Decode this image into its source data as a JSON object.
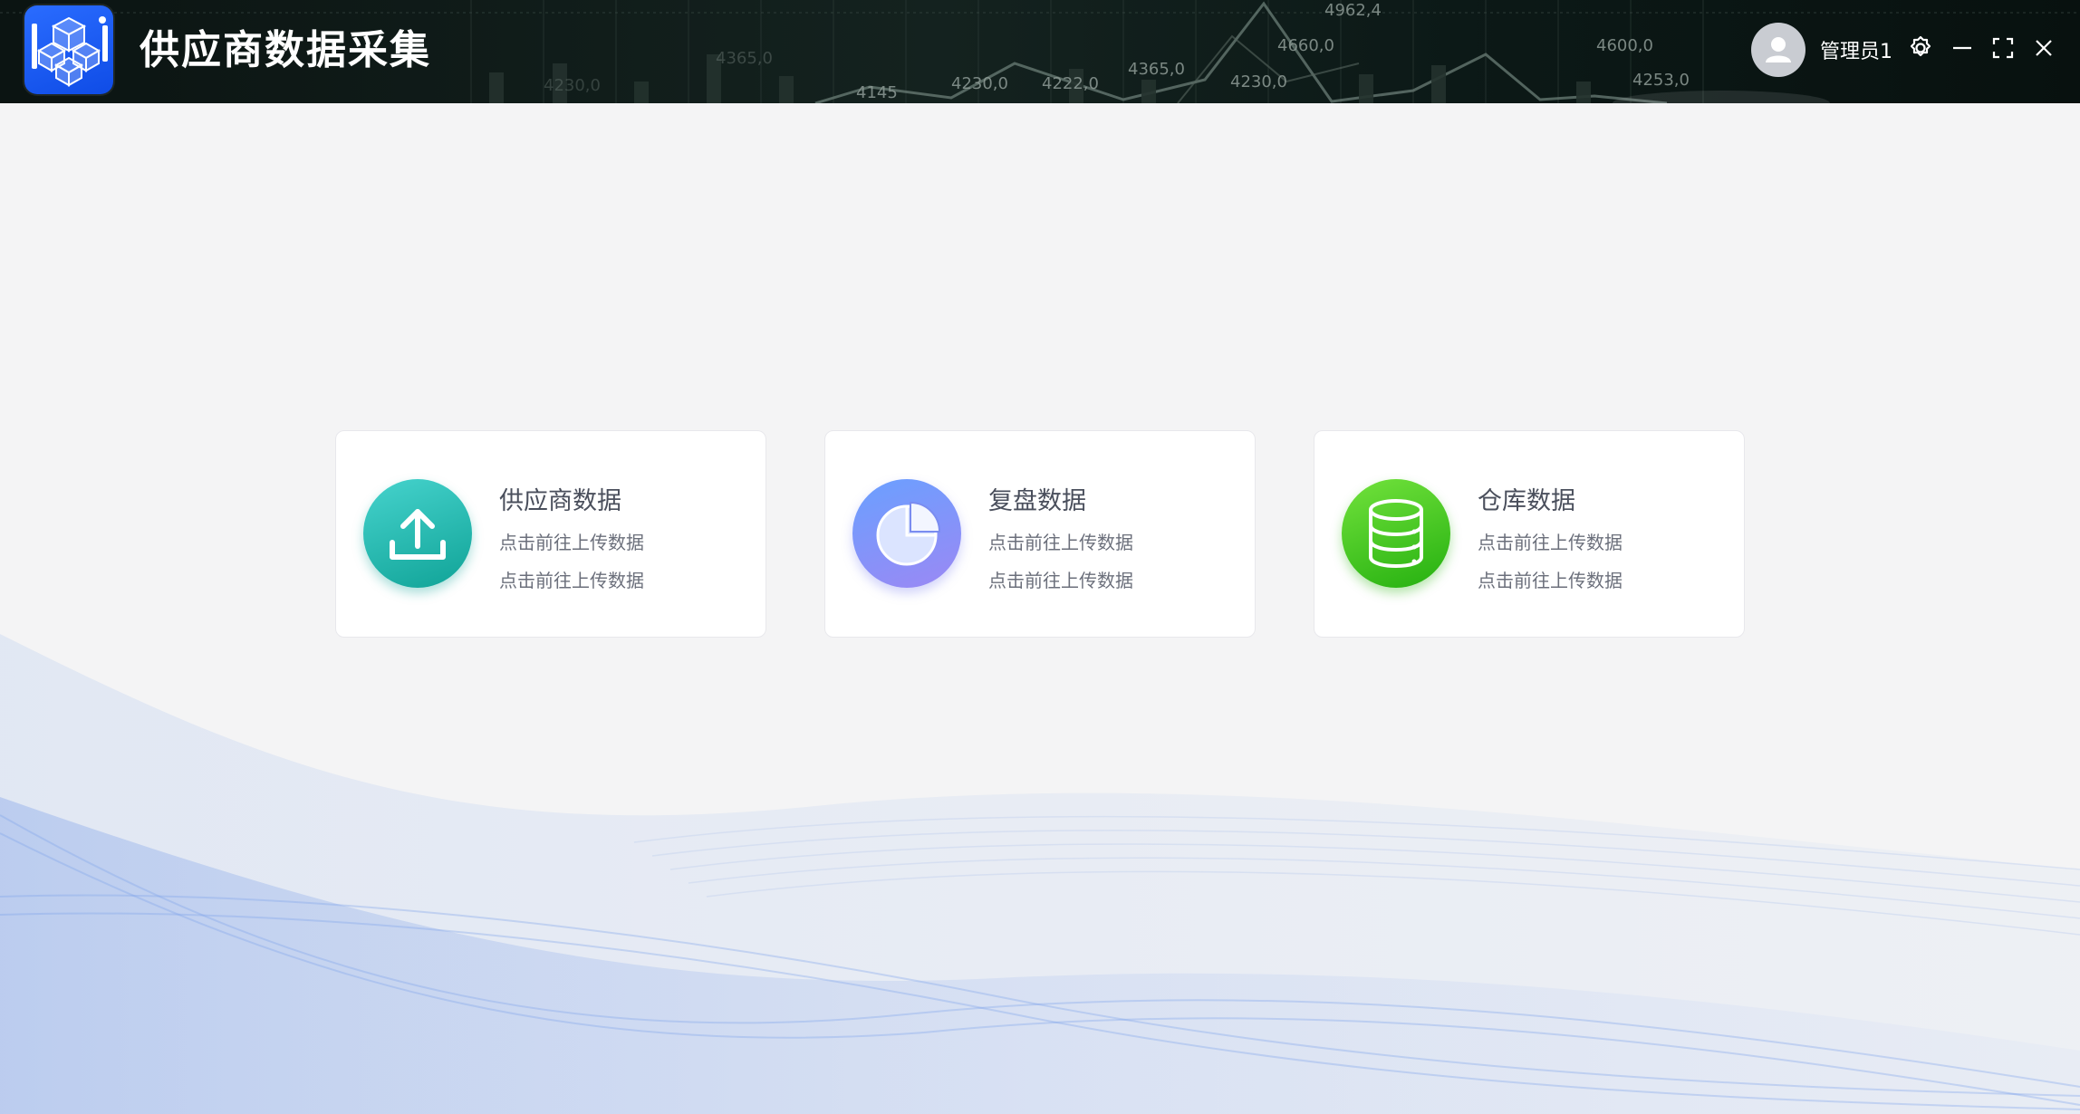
{
  "app": {
    "title": "供应商数据采集"
  },
  "header": {
    "ticker_values": [
      "4962,4",
      "4660,0",
      "4365,0",
      "4600,0",
      "4253,0",
      "4230,0",
      "4230,0",
      "4222,0",
      "4145",
      "4365,0",
      "4230,0"
    ],
    "user_name": "管理员1"
  },
  "cards": [
    {
      "title": "供应商数据",
      "line1": "点击前往上传数据",
      "line2": "点击前往上传数据",
      "icon": "upload-icon",
      "gradient": [
        "#3fd0c8",
        "#13a69a"
      ]
    },
    {
      "title": "复盘数据",
      "line1": "点击前往上传数据",
      "line2": "点击前往上传数据",
      "icon": "pie-chart-icon",
      "gradient": [
        "#6c9cff",
        "#9a8cf5"
      ]
    },
    {
      "title": "仓库数据",
      "line1": "点击前往上传数据",
      "line2": "点击前往上传数据",
      "icon": "database-icon",
      "gradient": [
        "#6fe03a",
        "#2bb512"
      ]
    }
  ],
  "colors": {
    "background": "#f4f4f5",
    "header_bg": "#0f1c19",
    "logo_blue": "#1a5cf5",
    "wave_blue": "#8fb0ee"
  }
}
